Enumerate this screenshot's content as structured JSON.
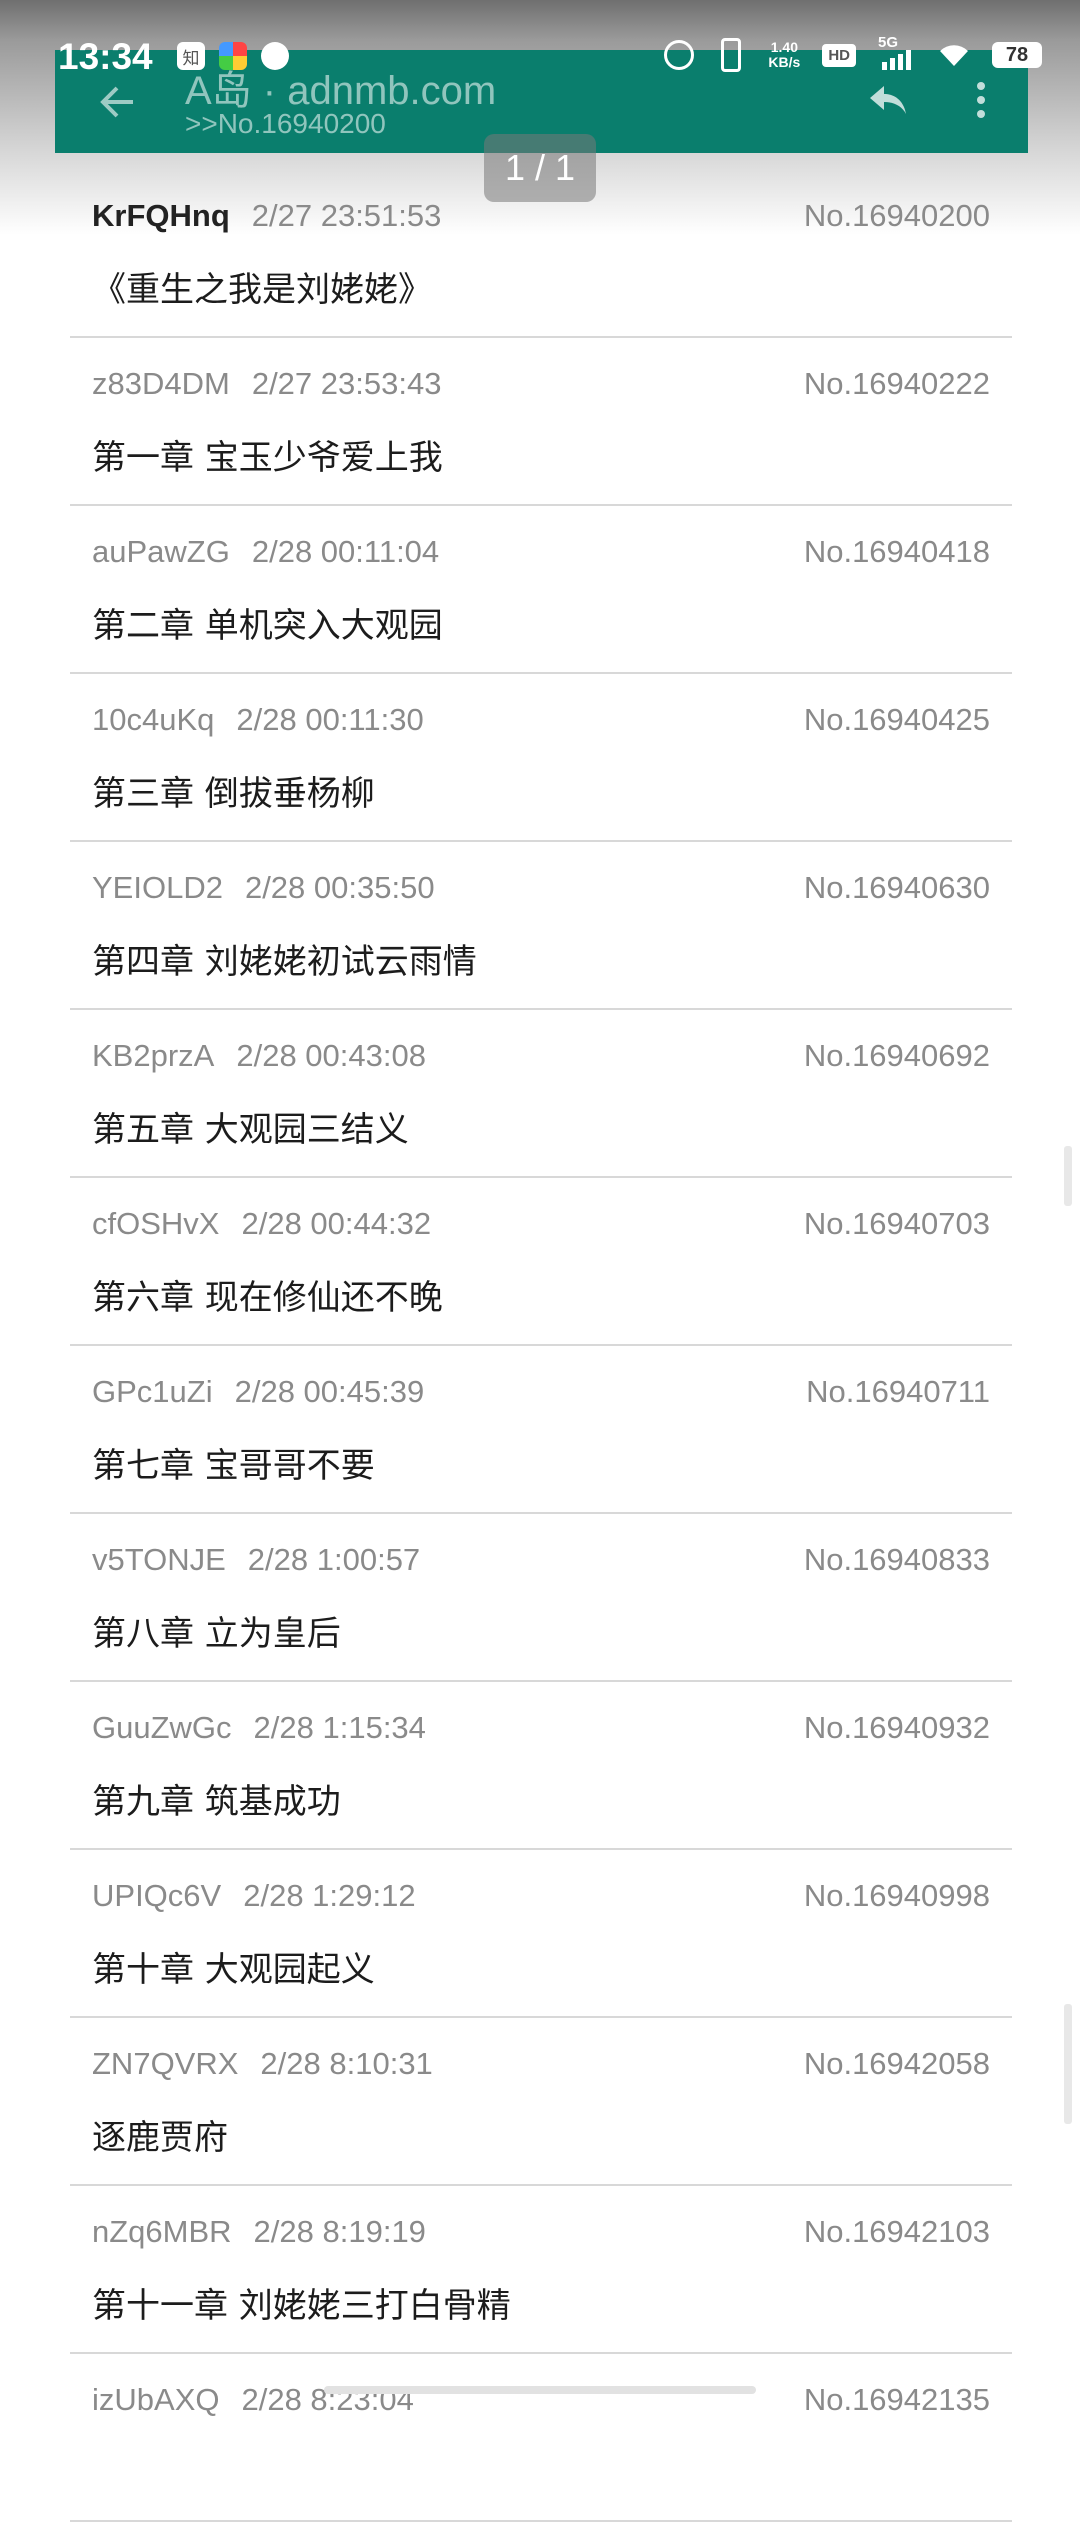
{
  "status_bar": {
    "time": "13:34",
    "left_icons": [
      "zhihu-icon",
      "photos-icon",
      "chat-bubble-icon"
    ],
    "zhihu_glyph": "知",
    "net_speed_value": "1.40",
    "net_speed_unit": "KB/s",
    "hd_label": "HD",
    "network_label": "5G",
    "battery": "78"
  },
  "toolbar": {
    "title": "A岛 · adnmb.com",
    "subtitle": ">>No.16940200"
  },
  "pager": {
    "label": "1 / 1"
  },
  "posts": [
    {
      "user": "KrFQHnq",
      "time": "2/27 23:51:53",
      "no": "No.16940200",
      "text": "《重生之我是刘姥姥》"
    },
    {
      "user": "z83D4DM",
      "time": "2/27 23:53:43",
      "no": "No.16940222",
      "text": "第一章 宝玉少爷爱上我"
    },
    {
      "user": "auPawZG",
      "time": "2/28 00:11:04",
      "no": "No.16940418",
      "text": "第二章 单机突入大观园"
    },
    {
      "user": "10c4uKq",
      "time": "2/28 00:11:30",
      "no": "No.16940425",
      "text": "第三章 倒拔垂杨柳"
    },
    {
      "user": "YEIOLD2",
      "time": "2/28 00:35:50",
      "no": "No.16940630",
      "text": "第四章 刘姥姥初试云雨情"
    },
    {
      "user": "KB2przA",
      "time": "2/28 00:43:08",
      "no": "No.16940692",
      "text": "第五章 大观园三结义"
    },
    {
      "user": "cfOSHvX",
      "time": "2/28 00:44:32",
      "no": "No.16940703",
      "text": "第六章 现在修仙还不晚"
    },
    {
      "user": "GPc1uZi",
      "time": "2/28 00:45:39",
      "no": "No.16940711",
      "text": "第七章 宝哥哥不要"
    },
    {
      "user": "v5TONJE",
      "time": "2/28 1:00:57",
      "no": "No.16940833",
      "text": "第八章 立为皇后"
    },
    {
      "user": "GuuZwGc",
      "time": "2/28 1:15:34",
      "no": "No.16940932",
      "text": "第九章 筑基成功"
    },
    {
      "user": "UPIQc6V",
      "time": "2/28 1:29:12",
      "no": "No.16940998",
      "text": "第十章 大观园起义"
    },
    {
      "user": "ZN7QVRX",
      "time": "2/28 8:10:31",
      "no": "No.16942058",
      "text": "逐鹿贾府"
    },
    {
      "user": "nZq6MBR",
      "time": "2/28 8:19:19",
      "no": "No.16942103",
      "text": "第十一章  刘姥姥三打白骨精"
    },
    {
      "user": "izUbAXQ",
      "time": "2/28 8:23:04",
      "no": "No.16942135",
      "text": ""
    }
  ],
  "colors": {
    "toolbar": "#0a7e6d",
    "op_user": "#222222",
    "meta_gray": "#8a8a8a",
    "divider": "#d8d8d8"
  }
}
